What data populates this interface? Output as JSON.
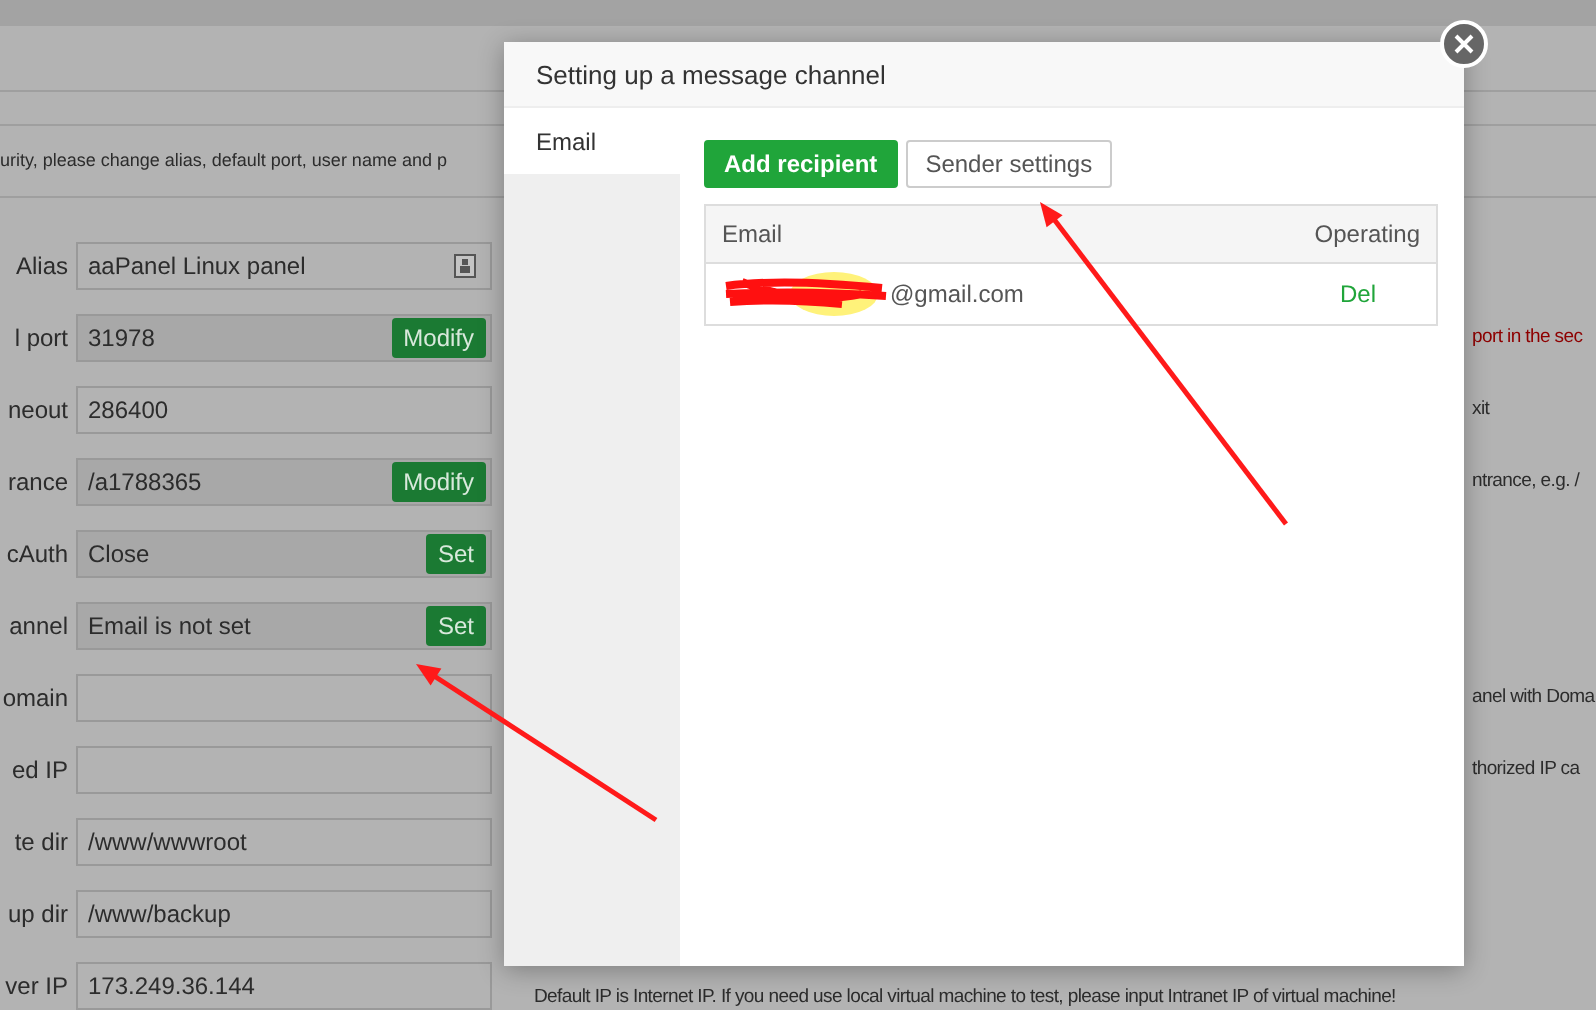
{
  "page": {
    "notice": "urity, please change alias, default port, user name and p",
    "rows": [
      {
        "label": "Alias",
        "value": "aaPanel Linux panel",
        "kind": "icon"
      },
      {
        "label": "l port",
        "value": "31978",
        "kind": "button",
        "button": "Modify",
        "note": {
          "text": "port in the sec",
          "warning": true,
          "kind": "clipped"
        }
      },
      {
        "label": "neout",
        "value": "286400",
        "kind": "plain",
        "note": {
          "text": "xit",
          "warning": false,
          "kind": "clipped"
        }
      },
      {
        "label": "rance",
        "value": "/a1788365",
        "kind": "button",
        "button": "Modify",
        "note": {
          "text": "ntrance, e.g. /",
          "warning": false,
          "kind": "clipped"
        }
      },
      {
        "label": "cAuth",
        "value": "Close",
        "kind": "button",
        "button": "Set"
      },
      {
        "label": "annel",
        "value": "Email is not set",
        "kind": "button",
        "button": "Set"
      },
      {
        "label": "omain",
        "value": "",
        "kind": "plain",
        "note": {
          "text": "anel with Doma",
          "warning": false,
          "kind": "clipped"
        }
      },
      {
        "label": "ed IP",
        "value": "",
        "kind": "plain",
        "note": {
          "text": "thorized IP ca",
          "warning": false,
          "kind": "clipped"
        }
      },
      {
        "label": "te dir",
        "value": "/www/wwwroot",
        "kind": "plain"
      },
      {
        "label": "up dir",
        "value": "/www/backup",
        "kind": "plain"
      },
      {
        "label": "ver IP",
        "value": "173.249.36.144",
        "kind": "plain",
        "note": {
          "text": "Default IP is Internet IP. If you need use local virtual machine to test, please input Intranet IP of virtual machine!",
          "warning": false,
          "kind": "full"
        }
      }
    ]
  },
  "dialog": {
    "title": "Setting up a message channel",
    "tabs": [
      {
        "label": "Email",
        "selected": true
      }
    ],
    "buttons": [
      {
        "label": "Add recipient",
        "primary": true
      },
      {
        "label": "Sender settings",
        "primary": false
      }
    ],
    "table": {
      "columns": [
        "Email",
        "Operating"
      ],
      "rows": [
        {
          "email": "@gmail.com",
          "redacted": true,
          "action": "Del"
        }
      ]
    }
  }
}
